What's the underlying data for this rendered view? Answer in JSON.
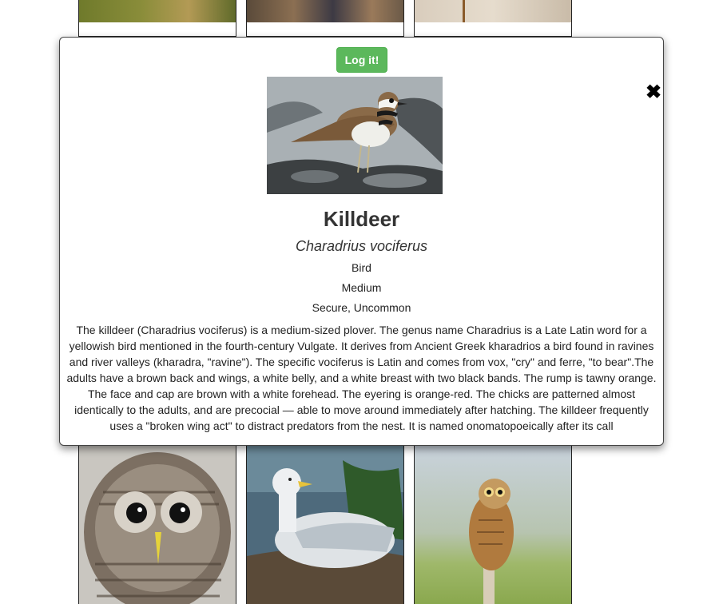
{
  "modal": {
    "log_button": "Log it!",
    "close_icon": "✖",
    "name": "Killdeer",
    "scientific_name": "Charadrius vociferus",
    "type": "Bird",
    "size": "Medium",
    "status": "Secure, Uncommon",
    "description": "The killdeer (Charadrius vociferus) is a medium-sized plover. The genus name Charadrius is a Late Latin word for a yellowish bird mentioned in the fourth-century Vulgate. It derives from Ancient Greek kharadrios a bird found in ravines and river valleys (kharadra, \"ravine\"). The specific vociferus is Latin and comes from vox, \"cry\" and ferre, \"to bear\".The adults have a brown back and wings, a white belly, and a white breast with two black bands. The rump is tawny orange. The face and cap are brown with a white forehead. The eyering is orange-red. The chicks are patterned almost identically to the adults, and are precocial — able to move around immediately after hatching. The killdeer frequently uses a \"broken wing act\" to distract predators from the nest. It is named onomatopoeically after its call",
    "accent_color": "#5cb85c"
  },
  "gallery": {
    "top_cards": [
      "bird-photo",
      "bird-photo",
      "bird-photo"
    ],
    "bottom_cards": [
      "barred-owl-photo",
      "gull-on-nest-photo",
      "short-eared-owl-photo"
    ]
  }
}
